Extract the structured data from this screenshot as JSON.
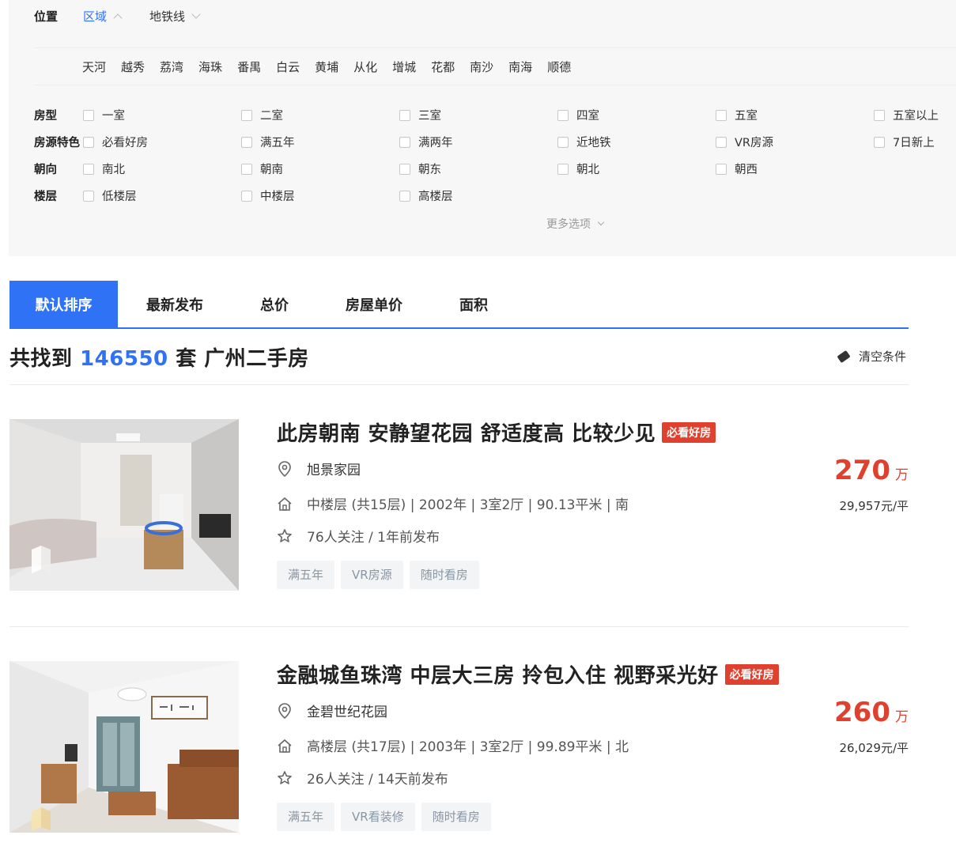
{
  "location": {
    "label": "位置",
    "tabs": [
      {
        "label": "区域",
        "active": true
      },
      {
        "label": "地铁线",
        "active": false
      }
    ],
    "districts": [
      "天河",
      "越秀",
      "荔湾",
      "海珠",
      "番禺",
      "白云",
      "黄埔",
      "从化",
      "增城",
      "花都",
      "南沙",
      "南海",
      "顺德"
    ]
  },
  "filters": [
    {
      "label": "房型",
      "options": [
        "一室",
        "二室",
        "三室",
        "四室",
        "五室",
        "五室以上"
      ]
    },
    {
      "label": "房源特色",
      "options": [
        "必看好房",
        "满五年",
        "满两年",
        "近地铁",
        "VR房源",
        "7日新上"
      ]
    },
    {
      "label": "朝向",
      "options": [
        "南北",
        "朝南",
        "朝东",
        "朝北",
        "朝西"
      ]
    },
    {
      "label": "楼层",
      "options": [
        "低楼层",
        "中楼层",
        "高楼层"
      ]
    }
  ],
  "more_options": "更多选项",
  "sort_tabs": [
    {
      "label": "默认排序",
      "active": true
    },
    {
      "label": "最新发布",
      "active": false
    },
    {
      "label": "总价",
      "active": false
    },
    {
      "label": "房屋单价",
      "active": false
    },
    {
      "label": "面积",
      "active": false
    }
  ],
  "results": {
    "prefix": "共找到",
    "count": "146550",
    "suffix": "套 广州二手房",
    "clear_label": "清空条件"
  },
  "listings": [
    {
      "title": "此房朝南 安静望花园 舒适度高 比较少见",
      "badge": "必看好房",
      "community": "旭景家园",
      "details": "中楼层 (共15层) | 2002年 | 3室2厅 | 90.13平米 | 南",
      "followers": "76人关注 / 1年前发布",
      "tags": [
        "满五年",
        "VR房源",
        "随时看房"
      ],
      "price": "270",
      "price_unit": "万",
      "unit_price": "29,957元/平"
    },
    {
      "title": "金融城鱼珠湾 中层大三房 拎包入住 视野采光好",
      "badge": "必看好房",
      "community": "金碧世纪花园",
      "details": "高楼层 (共17层) | 2003年 | 3室2厅 | 99.89平米 | 北",
      "followers": "26人关注 / 14天前发布",
      "tags": [
        "满五年",
        "VR看装修",
        "随时看房"
      ],
      "price": "260",
      "price_unit": "万",
      "unit_price": "26,029元/平"
    }
  ],
  "colors": {
    "accent": "#3072f6",
    "price": "#e0412f",
    "badge": "#e0412f",
    "panel_bg": "#f7f7f8"
  }
}
